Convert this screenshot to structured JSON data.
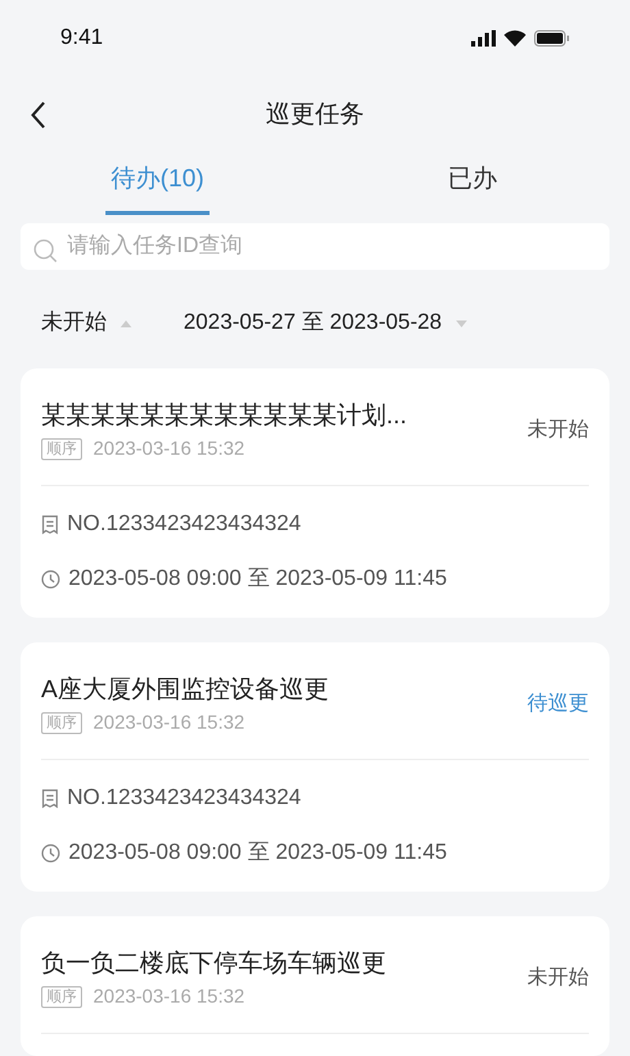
{
  "status_bar": {
    "time": "9:41"
  },
  "nav": {
    "title": "巡更任务"
  },
  "tabs": [
    {
      "label": "待办(10)",
      "selected": true
    },
    {
      "label": "已办",
      "selected": false
    }
  ],
  "search": {
    "placeholder": "请输入任务ID查询"
  },
  "filters": [
    {
      "label": "未开始",
      "kind": "up"
    },
    {
      "label": "2023-05-27 至 2023-05-28",
      "kind": "down"
    }
  ],
  "tasks": [
    {
      "title": "某某某某某某某某某某某某计划...",
      "tag": "顺序",
      "created": "2023-03-16 15:32",
      "status": {
        "label": "未开始",
        "kind": "not_started"
      },
      "number": "NO.1233423423434324",
      "period": "2023-05-08 09:00 至 2023-05-09 11:45"
    },
    {
      "title": "A座大厦外围监控设备巡更",
      "tag": "顺序",
      "created": "2023-03-16 15:32",
      "status": {
        "label": "待巡更",
        "kind": "pending"
      },
      "number": "NO.1233423423434324",
      "period": "2023-05-08 09:00 至 2023-05-09 11:45"
    },
    {
      "title": "负一负二楼底下停车场车辆巡更",
      "tag": "顺序",
      "created": "2023-03-16 15:32",
      "status": {
        "label": "未开始",
        "kind": "not_started"
      }
    }
  ]
}
